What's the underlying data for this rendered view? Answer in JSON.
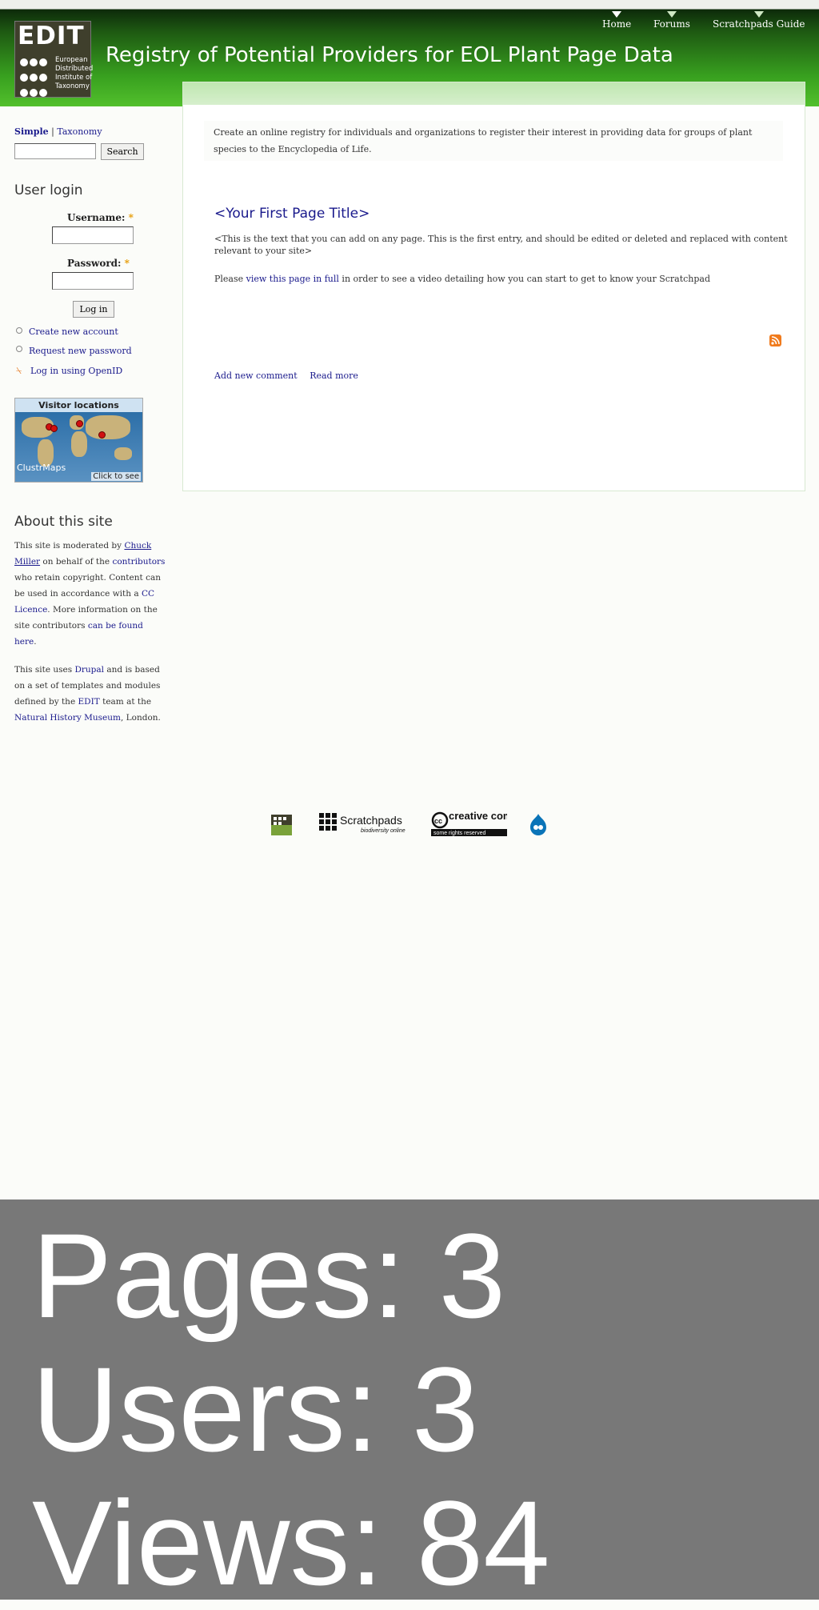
{
  "header": {
    "logo": {
      "word": "EDIT",
      "institute_lines": [
        "European",
        "Distributed",
        "Institute of",
        "Taxonomy"
      ]
    },
    "site_title": "Registry of Potential Providers for EOL Plant Page Data",
    "nav": [
      {
        "label": "Home"
      },
      {
        "label": "Forums"
      },
      {
        "label": "Scratchpads Guide"
      }
    ],
    "colors": {
      "header_dark": "#0d2a0a",
      "header_light": "#52c02c"
    }
  },
  "sidebar": {
    "search": {
      "tab_simple": "Simple",
      "tab_separator": "|",
      "tab_taxonomy": "Taxonomy",
      "input_value": "",
      "button_label": "Search"
    },
    "user_login": {
      "title": "User login",
      "username_label": "Username:",
      "password_label": "Password:",
      "required_mark": "*",
      "username_value": "",
      "password_value": "",
      "button_label": "Log in",
      "links": {
        "create_account": "Create new account",
        "request_password": "Request new password",
        "openid": "Log in using OpenID"
      }
    },
    "clustrmap": {
      "title": "Visitor locations",
      "brand": "ClustrMaps",
      "cta": "Click to see"
    },
    "about": {
      "title": "About this site",
      "p1_prefix": "This site is moderated by",
      "p1_moderator": "Chuck Miller",
      "p1_mid": "on behalf of the",
      "p1_contributors": "contributors",
      "p1_after": "who retain copyright. Content can be used in accordance with a",
      "p1_licence": "CC Licence",
      "p1_more": ". More information on the site contributors",
      "p1_found": "can be found here",
      "p1_end": ".",
      "p2_prefix": "This site uses",
      "p2_drupal": "Drupal",
      "p2_mid": "and is based on a set of templates and modules defined by the",
      "p2_edit": "EDIT",
      "p2_team": "team at the",
      "p2_nhm": "Natural History Museum",
      "p2_end": ", London."
    }
  },
  "main": {
    "mission": "Create an online registry for individuals and organizations to register their interest in providing data for groups of plant species to the Encyclopedia of Life.",
    "node": {
      "title": "<Your First Page Title>",
      "body_p1": "<This is the text that you can add on any page. This is the first entry, and should be edited or deleted and replaced with content relevant to your site>",
      "body_p2_prefix": "Please",
      "body_p2_link": "view this page in full",
      "body_p2_suffix": "in order to see a video detailing how you can start to get to know your Scratchpad",
      "links": {
        "add_comment": "Add new comment",
        "read_more": "Read more"
      }
    },
    "feed_icon": "rss-feed-icon"
  },
  "footer": {
    "logos": [
      {
        "icon": "edit-logo-icon"
      },
      {
        "icon": "scratchpads-logo-icon",
        "text": "Scratchpads",
        "tagline": "biodiversity online"
      },
      {
        "icon": "creative-commons-logo-icon",
        "text": "creative commons",
        "tagline": "some rights reserved"
      },
      {
        "icon": "drupal-logo-icon"
      }
    ]
  },
  "stats": {
    "pages": "Pages: 3",
    "users": "Users: 3",
    "views": "Views: 84",
    "background": "#787878"
  }
}
